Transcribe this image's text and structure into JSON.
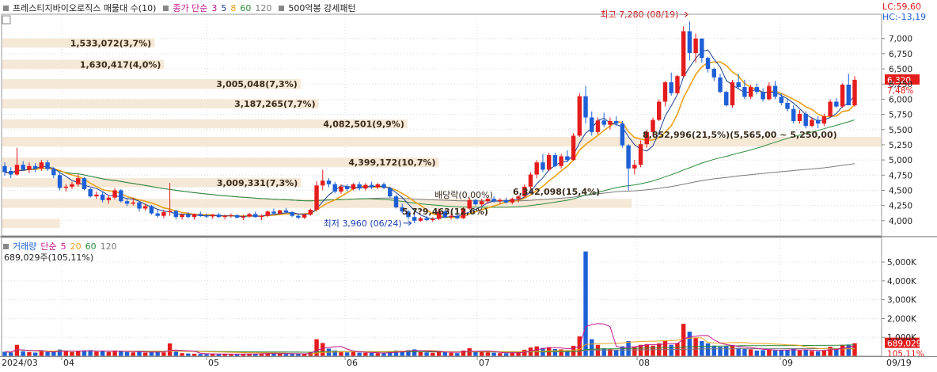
{
  "price_panel": {
    "legend": {
      "title": "프레스티지바이오로직스 매물대 수(10)",
      "ma_label": "종가 단순",
      "ma_periods": [
        "3",
        "5",
        "8",
        "60",
        "120"
      ],
      "extra": "500억봉 강세패턴"
    },
    "lc_label": "LC:59,60",
    "hc_label": "HC:-13,19",
    "current_price_label": "6,320",
    "change_label": "7,48%",
    "high_annotation": "최고 7,280 (08/19)",
    "low_annotation": "최저 3,960 (06/24)",
    "dividend_annotation": "배당락(0,00%)",
    "price_annotations": [
      "6,342,098(15,4%)",
      "5,7?9,463(12,6%)"
    ],
    "range_annotation": "8,852,996(21,5%)(5,565,00 ~ 5,250,00)"
  },
  "volume_panel": {
    "legend": {
      "title": "거래량",
      "ma_label": "단순",
      "ma_periods": [
        "5",
        "20",
        "60",
        "120"
      ]
    },
    "value_label": "689,029주(105,11%)",
    "current_volume_label": "689,029",
    "current_ratio_label": "105,11%"
  },
  "colors": {
    "up": "#e41c1c",
    "down": "#1d5fd6",
    "ma3": "#1f3f8f",
    "ma5": "#1f3f8f",
    "ma8": "#e8a11a",
    "ma60": "#2e8b3a",
    "ma120": "#7a7a7a",
    "profile": "#f5e6d3",
    "lc": "#e41c1c",
    "hc": "#1d5fd6"
  },
  "chart_data": {
    "type": "candlestick",
    "x_labels": [
      "2024/03",
      "04",
      "05",
      "06",
      "07",
      "08",
      "09",
      "09/19"
    ],
    "y_ticks": [
      "7,000",
      "6,750",
      "6,500",
      "6,250",
      "6,000",
      "5,750",
      "5,500",
      "5,250",
      "5,000",
      "4,750",
      "4,500",
      "4,250",
      "4,000"
    ],
    "ylim": [
      3750,
      7400
    ],
    "volume_ticks": [
      "5,000K",
      "4,000K",
      "3,000K",
      "2,000K",
      "1,000K"
    ],
    "volume_ylim": [
      0,
      5800000
    ],
    "volume_profile": [
      {
        "label": "1,533,072(3,7%)",
        "low": 6850,
        "high": 7000
      },
      {
        "label": "1,630,417(4,0%)",
        "low": 6500,
        "high": 6650
      },
      {
        "label": "3,005,048(7,3%)",
        "low": 6170,
        "high": 6330
      },
      {
        "label": "3,187,265(7,7%)",
        "low": 5850,
        "high": 6000
      },
      {
        "label": "4,082,501(9,9%)",
        "low": 5520,
        "high": 5670
      },
      {
        "label": "8,852,996(21,5%)",
        "low": 5220,
        "high": 5380
      },
      {
        "label": "4,399,172(10,7%)",
        "low": 4880,
        "high": 5040
      },
      {
        "label": "3,009,331(7,3%)",
        "low": 4550,
        "high": 4700
      },
      {
        "label": "6,342,098(15,4%)",
        "low": 4210,
        "high": 4360
      },
      {
        "label": "5,7?9,463(12,6%)",
        "low": 3880,
        "high": 4030
      }
    ],
    "candles": [
      [
        4900,
        4960,
        4740,
        4800,
        230000.0
      ],
      [
        4820,
        4880,
        4700,
        4760,
        200000.0
      ],
      [
        4760,
        5200,
        4740,
        4920,
        600000.0
      ],
      [
        4920,
        4980,
        4820,
        4840,
        260000.0
      ],
      [
        4840,
        4960,
        4780,
        4900,
        220000.0
      ],
      [
        4900,
        4950,
        4800,
        4860,
        190000.0
      ],
      [
        4860,
        5000,
        4820,
        4960,
        260000.0
      ],
      [
        4960,
        5000,
        4820,
        4850,
        220000.0
      ],
      [
        4850,
        4880,
        4700,
        4750,
        240000.0
      ],
      [
        4750,
        4800,
        4500,
        4540,
        350000.0
      ],
      [
        4540,
        4600,
        4480,
        4560,
        280000.0
      ],
      [
        4560,
        4640,
        4520,
        4600,
        220000.0
      ],
      [
        4600,
        4760,
        4560,
        4700,
        260000.0
      ],
      [
        4700,
        4720,
        4500,
        4520,
        300000.0
      ],
      [
        4520,
        4540,
        4380,
        4400,
        320000.0
      ],
      [
        4400,
        4480,
        4360,
        4430,
        240000.0
      ],
      [
        4430,
        4480,
        4300,
        4340,
        260000.0
      ],
      [
        4340,
        4420,
        4280,
        4380,
        220000.0
      ],
      [
        4380,
        4540,
        4350,
        4500,
        300000.0
      ],
      [
        4500,
        4520,
        4300,
        4320,
        280000.0
      ],
      [
        4320,
        4360,
        4240,
        4280,
        220000.0
      ],
      [
        4280,
        4380,
        4250,
        4300,
        200000.0
      ],
      [
        4300,
        4320,
        4150,
        4200,
        240000.0
      ],
      [
        4200,
        4280,
        4160,
        4240,
        190000.0
      ],
      [
        4240,
        4260,
        4100,
        4120,
        230000.0
      ],
      [
        4120,
        4180,
        4050,
        4080,
        260000.0
      ],
      [
        4080,
        4180,
        4040,
        4140,
        200000.0
      ],
      [
        4140,
        4620,
        4080,
        4160,
        680000.0
      ],
      [
        4160,
        4180,
        4020,
        4060,
        240000.0
      ],
      [
        4060,
        4120,
        4020,
        4100,
        160000.0
      ],
      [
        4100,
        4140,
        4040,
        4060,
        140000.0
      ],
      [
        4060,
        4120,
        4020,
        4110,
        130000.0
      ],
      [
        4110,
        4150,
        4060,
        4080,
        120000.0
      ],
      [
        4080,
        4120,
        4040,
        4070,
        110000.0
      ],
      [
        4070,
        4110,
        4030,
        4100,
        100000.0
      ],
      [
        4100,
        4130,
        4050,
        4060,
        110000.0
      ],
      [
        4060,
        4100,
        4020,
        4080,
        120000.0
      ],
      [
        4080,
        4120,
        4050,
        4090,
        100000.0
      ],
      [
        4090,
        4110,
        4040,
        4050,
        110000.0
      ],
      [
        4050,
        4100,
        4010,
        4070,
        120000.0
      ],
      [
        4070,
        4130,
        4050,
        4110,
        130000.0
      ],
      [
        4110,
        4150,
        4050,
        4060,
        120000.0
      ],
      [
        4060,
        4100,
        4010,
        4080,
        140000.0
      ],
      [
        4080,
        4170,
        4060,
        4150,
        160000.0
      ],
      [
        4150,
        4200,
        4100,
        4120,
        150000.0
      ],
      [
        4120,
        4180,
        4100,
        4170,
        130000.0
      ],
      [
        4170,
        4210,
        4120,
        4140,
        120000.0
      ],
      [
        4140,
        4160,
        4060,
        4080,
        130000.0
      ],
      [
        4080,
        4120,
        4020,
        4050,
        120000.0
      ],
      [
        4050,
        4120,
        4030,
        4100,
        140000.0
      ],
      [
        4100,
        4200,
        4080,
        4180,
        200000.0
      ],
      [
        4180,
        4650,
        4150,
        4580,
        900000.0
      ],
      [
        4580,
        4840,
        4500,
        4660,
        700000.0
      ],
      [
        4660,
        4700,
        4550,
        4600,
        400000.0
      ],
      [
        4600,
        4640,
        4450,
        4480,
        300000.0
      ],
      [
        4480,
        4600,
        4440,
        4560,
        260000.0
      ],
      [
        4560,
        4600,
        4480,
        4520,
        200000.0
      ],
      [
        4520,
        4620,
        4500,
        4600,
        220000.0
      ],
      [
        4600,
        4640,
        4500,
        4530,
        190000.0
      ],
      [
        4530,
        4620,
        4500,
        4590,
        180000.0
      ],
      [
        4590,
        4640,
        4520,
        4550,
        170000.0
      ],
      [
        4550,
        4620,
        4520,
        4600,
        160000.0
      ],
      [
        4600,
        4630,
        4520,
        4540,
        150000.0
      ],
      [
        4540,
        4560,
        4380,
        4400,
        260000.0
      ],
      [
        4400,
        4420,
        4200,
        4220,
        300000.0
      ],
      [
        4220,
        4280,
        4120,
        4150,
        280000.0
      ],
      [
        4150,
        4180,
        4020,
        4060,
        320000.0
      ],
      [
        4060,
        4120,
        3960,
        4000,
        360000.0
      ],
      [
        4000,
        4060,
        3980,
        4040,
        240000.0
      ],
      [
        4040,
        4080,
        3990,
        4010,
        200000.0
      ],
      [
        4010,
        4060,
        3980,
        4030,
        180000.0
      ],
      [
        4030,
        4200,
        4010,
        4150,
        280000.0
      ],
      [
        4150,
        4180,
        4040,
        4060,
        220000.0
      ],
      [
        4060,
        4120,
        4020,
        4080,
        180000.0
      ],
      [
        4080,
        4140,
        4020,
        4040,
        160000.0
      ],
      [
        4040,
        4220,
        4030,
        4200,
        300000.0
      ],
      [
        4200,
        4380,
        4180,
        4340,
        420000.0
      ],
      [
        4340,
        4360,
        4250,
        4270,
        240000.0
      ],
      [
        4270,
        4360,
        4240,
        4320,
        220000.0
      ],
      [
        4320,
        4380,
        4280,
        4360,
        200000.0
      ],
      [
        4360,
        4400,
        4300,
        4320,
        180000.0
      ],
      [
        4320,
        4370,
        4280,
        4340,
        160000.0
      ],
      [
        4340,
        4380,
        4280,
        4300,
        150000.0
      ],
      [
        4300,
        4380,
        4270,
        4360,
        190000.0
      ],
      [
        4360,
        4420,
        4300,
        4400,
        220000.0
      ],
      [
        4400,
        4600,
        4380,
        4560,
        340000.0
      ],
      [
        4560,
        4800,
        4520,
        4760,
        460000.0
      ],
      [
        4760,
        5000,
        4700,
        4960,
        520000.0
      ],
      [
        4960,
        5100,
        4800,
        4840,
        440000.0
      ],
      [
        4840,
        5120,
        4820,
        5080,
        480000.0
      ],
      [
        5080,
        5120,
        4880,
        4900,
        380000.0
      ],
      [
        4900,
        5100,
        4860,
        5060,
        360000.0
      ],
      [
        5060,
        5160,
        4960,
        5000,
        320000.0
      ],
      [
        5000,
        5440,
        4980,
        5400,
        550000.0
      ],
      [
        5400,
        6100,
        5380,
        6050,
        1050000.0
      ],
      [
        6050,
        6220,
        5600,
        5700,
        5560000.0
      ],
      [
        5700,
        5800,
        5400,
        5460,
        900000.0
      ],
      [
        5460,
        5700,
        5420,
        5650,
        600000.0
      ],
      [
        5650,
        5780,
        5540,
        5580,
        420000.0
      ],
      [
        5580,
        5700,
        5500,
        5640,
        380000.0
      ],
      [
        5640,
        5720,
        5560,
        5600,
        320000.0
      ],
      [
        5600,
        5640,
        5200,
        5240,
        520000.0
      ],
      [
        5240,
        5260,
        4500,
        4860,
        800000.0
      ],
      [
        4860,
        5000,
        4760,
        4920,
        480000.0
      ],
      [
        4920,
        5320,
        4880,
        5260,
        600000.0
      ],
      [
        5260,
        5500,
        5200,
        5460,
        640000.0
      ],
      [
        5460,
        5700,
        5400,
        5660,
        560000.0
      ],
      [
        5660,
        6000,
        5640,
        5960,
        680000.0
      ],
      [
        5960,
        6300,
        5880,
        6280,
        820000.0
      ],
      [
        6280,
        6440,
        6060,
        6100,
        600000.0
      ],
      [
        6100,
        6400,
        6080,
        6380,
        700000.0
      ],
      [
        6380,
        7200,
        6360,
        7120,
        1720000.0
      ],
      [
        7120,
        7280,
        6640,
        6760,
        1300000.0
      ],
      [
        6760,
        7080,
        6600,
        7000,
        960000.0
      ],
      [
        7000,
        7000,
        6600,
        6680,
        800000.0
      ],
      [
        6680,
        6700,
        6440,
        6500,
        680000.0
      ],
      [
        6500,
        6520,
        6300,
        6360,
        560000.0
      ],
      [
        6360,
        6420,
        6100,
        6120,
        500000.0
      ],
      [
        6120,
        6140,
        5880,
        5900,
        520000.0
      ],
      [
        5900,
        6320,
        5860,
        6280,
        580000.0
      ],
      [
        6280,
        6420,
        6180,
        6200,
        440000.0
      ],
      [
        6200,
        6320,
        6000,
        6040,
        400000.0
      ],
      [
        6040,
        6240,
        6000,
        6200,
        360000.0
      ],
      [
        6200,
        6260,
        6080,
        6120,
        300000.0
      ],
      [
        6120,
        6180,
        5960,
        6000,
        320000.0
      ],
      [
        6000,
        6280,
        5980,
        6220,
        360000.0
      ],
      [
        6220,
        6300,
        6000,
        6040,
        300000.0
      ],
      [
        6040,
        6100,
        5900,
        5940,
        320000.0
      ],
      [
        5940,
        6000,
        5800,
        5840,
        340000.0
      ],
      [
        5840,
        5900,
        5600,
        5640,
        380000.0
      ],
      [
        5640,
        5820,
        5600,
        5760,
        300000.0
      ],
      [
        5760,
        5800,
        5520,
        5560,
        340000.0
      ],
      [
        5560,
        5700,
        5540,
        5660,
        280000.0
      ],
      [
        5660,
        5720,
        5520,
        5600,
        260000.0
      ],
      [
        5600,
        5760,
        5560,
        5720,
        320000.0
      ],
      [
        5720,
        6000,
        5700,
        5960,
        500000.0
      ],
      [
        5960,
        6020,
        5860,
        5880,
        400000.0
      ],
      [
        5880,
        6260,
        5860,
        6240,
        600000.0
      ],
      [
        6240,
        6420,
        5900,
        5900,
        620000.0
      ],
      [
        5900,
        6380,
        5880,
        6320,
        689000.0
      ]
    ]
  }
}
